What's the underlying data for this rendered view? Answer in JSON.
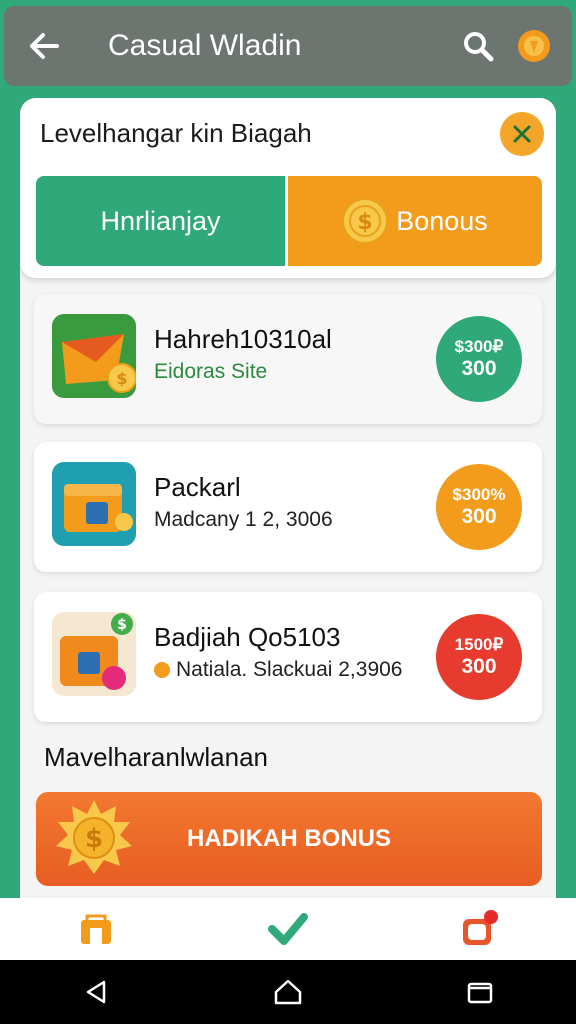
{
  "app": {
    "title": "Casual Wladin",
    "icons": {
      "back": "back-arrow-icon",
      "search": "search-icon",
      "profile": "coin-icon"
    }
  },
  "panel": {
    "title": "Levelhangar kin Biagah",
    "close_icon": "close-icon",
    "tabs": [
      {
        "label": "Hnrlianjay",
        "color": "#2fa97a"
      },
      {
        "label": "Bonous",
        "color": "#f39c1c",
        "icon": "coin-icon"
      }
    ]
  },
  "cards": [
    {
      "title": "Hahreh10310al",
      "subtitle": "Eidoras Site",
      "badge_line1": "$300₽",
      "badge_line2": "300",
      "badge_color": "#2fa97a"
    },
    {
      "title": "Packarl",
      "subtitle": "Madcany 1 2, 3006",
      "badge_line1": "$300%",
      "badge_line2": "300",
      "badge_color": "#f39c1c"
    },
    {
      "title": "Badjiah Qo5103",
      "subtitle": "Natiala. Slackuai 2,3906",
      "badge_line1": "1500₽",
      "badge_line2": "300",
      "badge_color": "#e63b2e"
    }
  ],
  "section": {
    "title": "Mavelharanlwlanan"
  },
  "bonus_button": {
    "label": "HADIKAH BONUS",
    "icon": "coin-burst-icon"
  },
  "bottom_nav": [
    {
      "icon": "shop-icon"
    },
    {
      "icon": "check-icon"
    },
    {
      "icon": "notification-box-icon"
    }
  ],
  "system_nav": [
    {
      "icon": "back-triangle-icon"
    },
    {
      "icon": "home-icon"
    },
    {
      "icon": "recents-icon"
    }
  ]
}
